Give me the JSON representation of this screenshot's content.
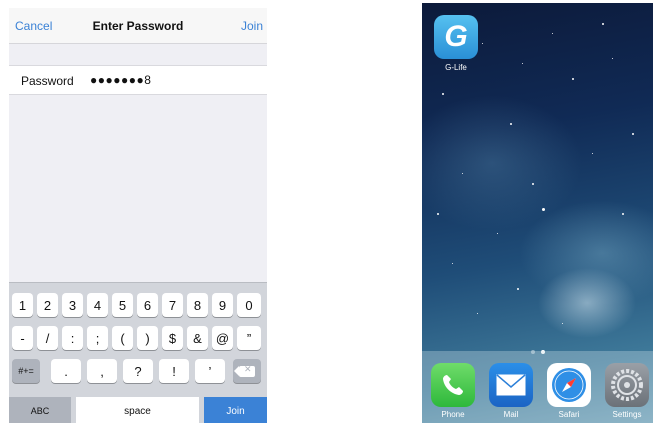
{
  "left_phone": {
    "nav": {
      "cancel": "Cancel",
      "title": "Enter Password",
      "join": "Join"
    },
    "password": {
      "label": "Password",
      "value": "●●●●●●●8"
    },
    "keyboard": {
      "row1": [
        "1",
        "2",
        "3",
        "4",
        "5",
        "6",
        "7",
        "8",
        "9",
        "0"
      ],
      "row2": [
        "-",
        "/",
        ":",
        ";",
        "(",
        ")",
        "$",
        "&",
        "@",
        "”"
      ],
      "row3": {
        "mode": "#+=",
        "keys": [
          ".",
          ",",
          "?",
          "!",
          "’"
        ],
        "delete": "⌫"
      },
      "row4": {
        "abc": "ABC",
        "space": "space",
        "join": "Join"
      }
    }
  },
  "right_phone": {
    "apps": [
      {
        "name": "G-Life",
        "icon": "g-life-icon",
        "glyph": "G"
      }
    ],
    "dock": [
      {
        "name": "Phone",
        "icon": "phone-icon"
      },
      {
        "name": "Mail",
        "icon": "mail-icon"
      },
      {
        "name": "Safari",
        "icon": "safari-icon"
      },
      {
        "name": "Settings",
        "icon": "settings-icon"
      }
    ],
    "page_indicator": {
      "pages": 2,
      "current": 2
    }
  },
  "colors": {
    "accent": "#3b82d6",
    "keyboard_bg": "#d2d5db",
    "screen_bg": "#efeff4"
  }
}
